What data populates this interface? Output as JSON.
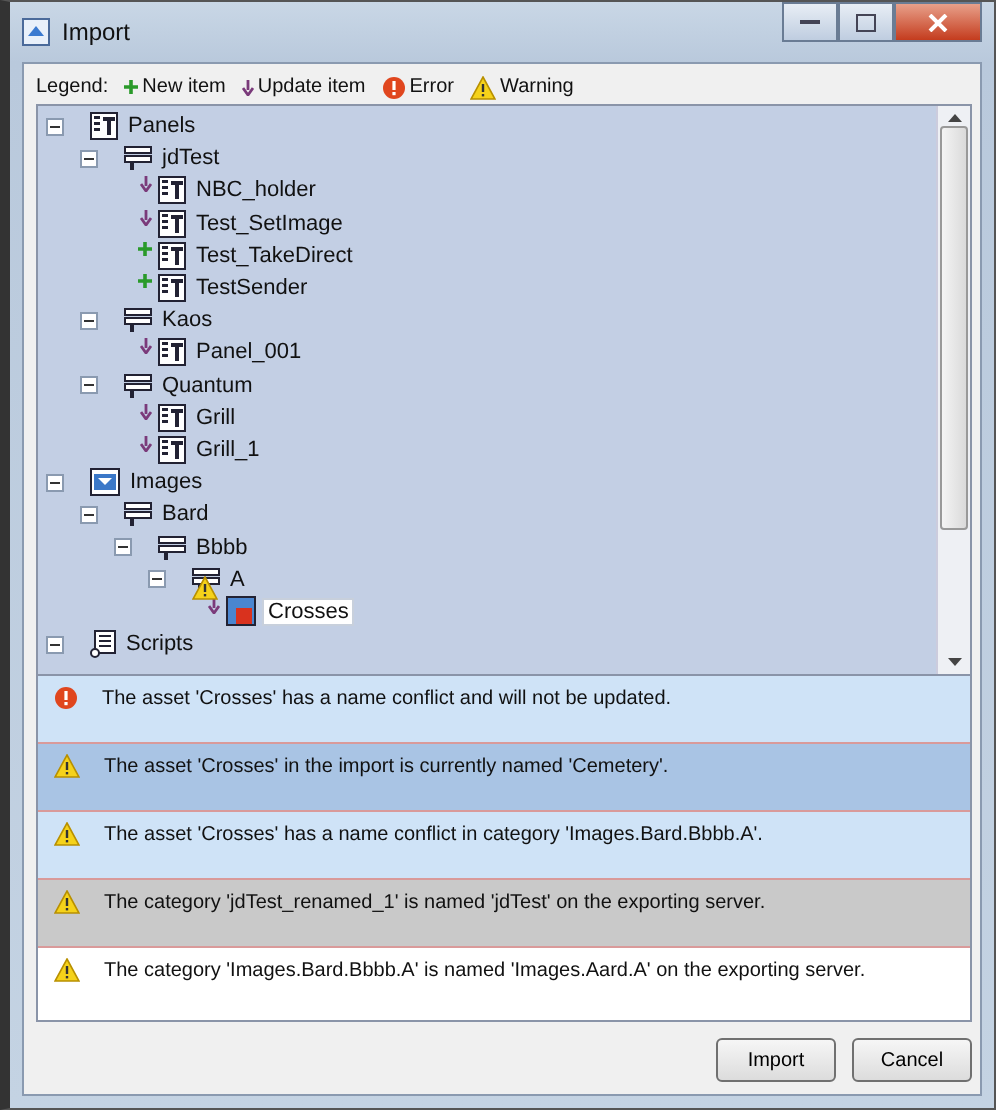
{
  "window": {
    "title": "Import"
  },
  "legend": {
    "label": "Legend:",
    "items": [
      {
        "kind": "new",
        "label": "New item"
      },
      {
        "kind": "update",
        "label": "Update item"
      },
      {
        "kind": "error",
        "label": "Error"
      },
      {
        "kind": "warning",
        "label": "Warning"
      }
    ]
  },
  "tree": [
    {
      "label": "Panels",
      "kind": "panel",
      "expanded": true,
      "selected": false,
      "children": [
        {
          "label": "jdTest",
          "kind": "category",
          "expanded": true,
          "selected": false,
          "children": [
            {
              "label": "NBC_holder",
              "kind": "panel",
              "updated": true,
              "selected": false
            },
            {
              "label": "Test_SetImage",
              "kind": "panel",
              "updated": true,
              "selected": false
            },
            {
              "label": "Test_TakeDirect",
              "kind": "panel",
              "added": true,
              "selected": false
            },
            {
              "label": "TestSender",
              "kind": "panel",
              "added": true,
              "selected": false
            }
          ]
        },
        {
          "label": "Kaos",
          "kind": "category",
          "expanded": true,
          "selected": false,
          "children": [
            {
              "label": "Panel_001",
              "kind": "panel",
              "updated": true,
              "selected": false
            }
          ]
        },
        {
          "label": "Quantum",
          "kind": "category",
          "expanded": true,
          "selected": false,
          "children": [
            {
              "label": "Grill",
              "kind": "panel",
              "updated": true,
              "selected": false
            },
            {
              "label": "Grill_1",
              "kind": "panel",
              "updated": true,
              "selected": false
            }
          ]
        }
      ]
    },
    {
      "label": "Images",
      "kind": "images",
      "expanded": true,
      "selected": false,
      "children": [
        {
          "label": "Bard",
          "kind": "category",
          "expanded": true,
          "selected": false,
          "children": [
            {
              "label": "Bbbb",
              "kind": "category",
              "expanded": true,
              "selected": false,
              "children": [
                {
                  "label": "A",
                  "kind": "category",
                  "expanded": true,
                  "warning": true,
                  "selected": false,
                  "children": [
                    {
                      "label": "Crosses",
                      "kind": "image",
                      "updated": true,
                      "selected": true
                    }
                  ]
                }
              ]
            }
          ]
        }
      ]
    },
    {
      "label": "Scripts",
      "kind": "script",
      "expanded": true,
      "selected": false
    }
  ],
  "messages": [
    {
      "kind": "error",
      "color": "#cfe3f7",
      "text": "The asset 'Crosses' has a name conflict and will not be updated."
    },
    {
      "kind": "warning",
      "color": "#a9c4e4",
      "text": "The asset 'Crosses' in the import is currently named 'Cemetery'."
    },
    {
      "kind": "warning",
      "color": "#cfe3f7",
      "text": "The asset 'Crosses' has a name conflict in category 'Images.Bard.Bbbb.A'."
    },
    {
      "kind": "warning",
      "color": "#c9c9c9",
      "text": "The category 'jdTest_renamed_1' is named 'jdTest' on the exporting server."
    },
    {
      "kind": "warning",
      "color": "#ffffff",
      "text": "The category 'Images.Bard.Bbbb.A' is named 'Images.Aard.A' on the exporting server."
    }
  ],
  "buttons": [
    "Import",
    "Cancel"
  ]
}
